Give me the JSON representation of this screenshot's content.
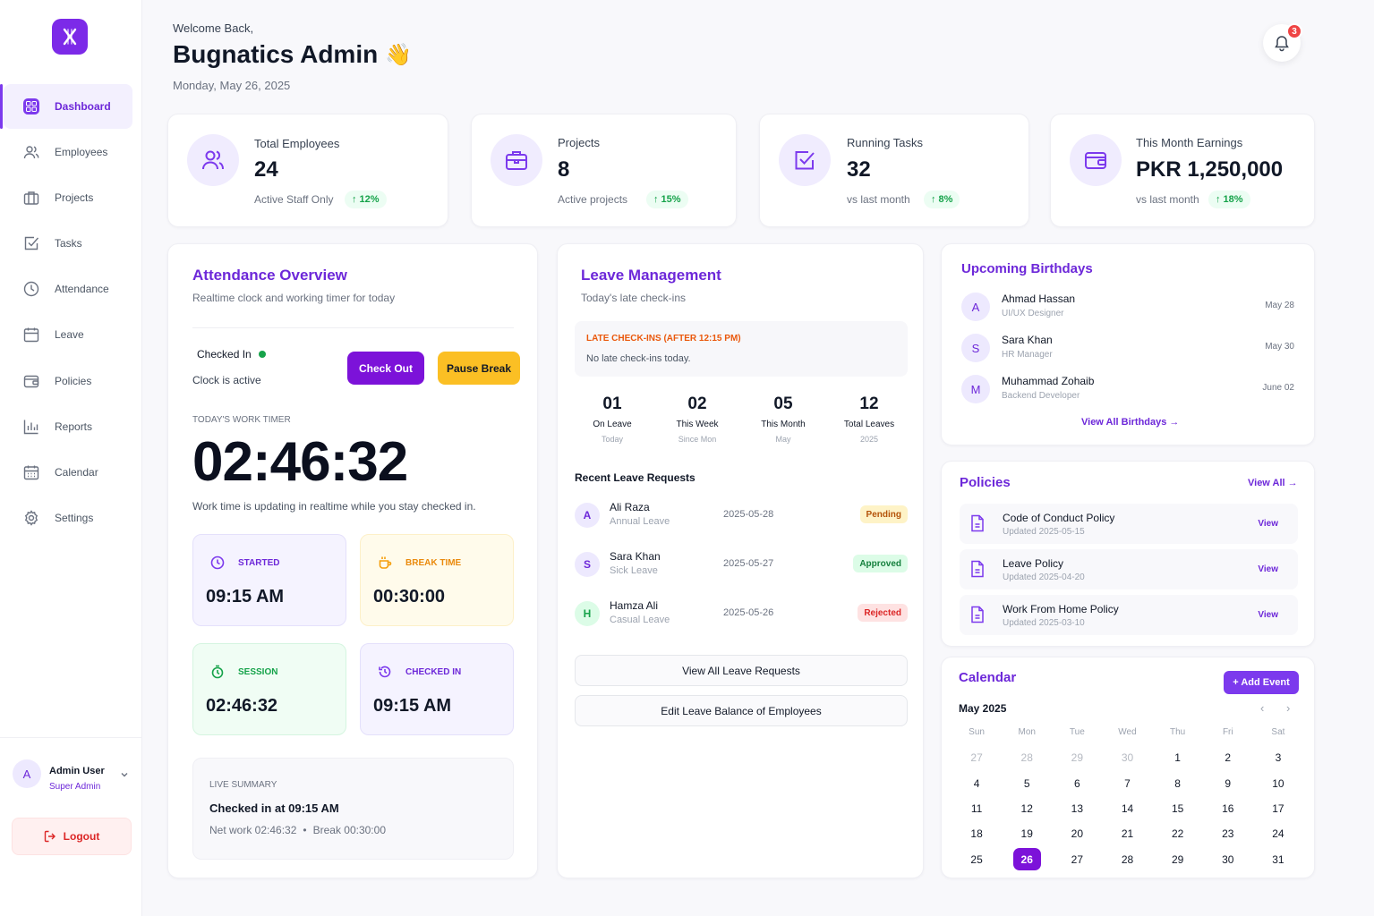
{
  "sidebar": {
    "items": [
      {
        "label": "Dashboard",
        "icon": "grid-icon"
      },
      {
        "label": "Employees",
        "icon": "users-icon"
      },
      {
        "label": "Projects",
        "icon": "briefcase-icon"
      },
      {
        "label": "Tasks",
        "icon": "check-square-icon"
      },
      {
        "label": "Attendance",
        "icon": "clock-icon"
      },
      {
        "label": "Leave",
        "icon": "calendar-icon"
      },
      {
        "label": "Policies",
        "icon": "wallet-icon"
      },
      {
        "label": "Reports",
        "icon": "bar-chart-icon"
      },
      {
        "label": "Calendar",
        "icon": "calendar-grid-icon"
      },
      {
        "label": "Settings",
        "icon": "gear-icon"
      }
    ],
    "profile": {
      "initial": "A",
      "name": "Admin User",
      "role": "Super Admin"
    },
    "logout_label": "Logout"
  },
  "header": {
    "welcome": "Welcome Back,",
    "name": "Bugnatics Admin",
    "emoji": "👋",
    "date": "Monday, May 26, 2025",
    "notification_count": "3"
  },
  "stats": [
    {
      "label": "Total Employees",
      "value": "24",
      "sub": "Active Staff Only",
      "trend": "↑ 12%",
      "icon": "users-icon"
    },
    {
      "label": "Projects",
      "value": "8",
      "sub": "Active projects",
      "trend": "↑ 15%",
      "icon": "briefcase-icon"
    },
    {
      "label": "Running Tasks",
      "value": "32",
      "sub": "vs last month",
      "trend": "↑ 8%",
      "icon": "check-square-icon"
    },
    {
      "label": "This Month Earnings",
      "value": "PKR 1,250,000",
      "sub": "vs last month",
      "trend": "↑ 18%",
      "icon": "wallet-icon"
    }
  ],
  "attendance": {
    "title": "Attendance Overview",
    "subtitle": "Realtime clock and working timer for today",
    "status": "Checked In",
    "clock_status": "Clock is active",
    "checkout_label": "Check Out",
    "pause_label": "Pause Break",
    "timer_label": "TODAY'S WORK TIMER",
    "timer": "02:46:32",
    "timer_note": "Work time is updating in realtime while you stay checked in.",
    "tiles": [
      {
        "label": "STARTED",
        "value": "09:15 AM"
      },
      {
        "label": "BREAK TIME",
        "value": "00:30:00"
      },
      {
        "label": "SESSION",
        "value": "02:46:32"
      },
      {
        "label": "CHECKED IN",
        "value": "09:15 AM"
      }
    ],
    "summary": {
      "label": "LIVE SUMMARY",
      "headline": "Checked in at 09:15 AM",
      "net": "Net work 02:46:32",
      "sep": "•",
      "break": "Break 00:30:00"
    }
  },
  "leave": {
    "title": "Leave Management",
    "subtitle": "Today's late check-ins",
    "late_title": "LATE CHECK-INS (AFTER 12:15 PM)",
    "late_text": "No late check-ins today.",
    "stats": [
      {
        "n": "01",
        "label": "On Leave",
        "sub": "Today"
      },
      {
        "n": "02",
        "label": "This Week",
        "sub": "Since Mon"
      },
      {
        "n": "05",
        "label": "This Month",
        "sub": "May"
      },
      {
        "n": "12",
        "label": "Total Leaves",
        "sub": "2025"
      }
    ],
    "recent_title": "Recent Leave Requests",
    "requests": [
      {
        "initial": "A",
        "name": "Ali Raza",
        "type": "Annual Leave",
        "date": "2025-05-28",
        "status": "Pending"
      },
      {
        "initial": "S",
        "name": "Sara Khan",
        "type": "Sick Leave",
        "date": "2025-05-27",
        "status": "Approved"
      },
      {
        "initial": "H",
        "name": "Hamza Ali",
        "type": "Casual Leave",
        "date": "2025-05-26",
        "status": "Rejected"
      }
    ],
    "view_all_label": "View All Leave Requests",
    "edit_balance_label": "Edit Leave Balance of Employees"
  },
  "birthdays": {
    "title": "Upcoming Birthdays",
    "people": [
      {
        "initial": "A",
        "name": "Ahmad Hassan",
        "role": "UI/UX Designer",
        "date": "May 28"
      },
      {
        "initial": "S",
        "name": "Sara Khan",
        "role": "HR Manager",
        "date": "May 30"
      },
      {
        "initial": "M",
        "name": "Muhammad Zohaib",
        "role": "Backend Developer",
        "date": "June 02"
      }
    ],
    "view_all": "View All Birthdays →"
  },
  "policies": {
    "title": "Policies",
    "view_all": "View All →",
    "items": [
      {
        "name": "Code of Conduct Policy",
        "updated": "Updated 2025-05-15",
        "action": "View"
      },
      {
        "name": "Leave Policy",
        "updated": "Updated 2025-04-20",
        "action": "View"
      },
      {
        "name": "Work From Home Policy",
        "updated": "Updated 2025-03-10",
        "action": "View"
      }
    ]
  },
  "calendar": {
    "title": "Calendar",
    "add_event": "+ Add Event",
    "month": "May 2025",
    "prev": "‹",
    "next": "›",
    "weekdays": [
      "Sun",
      "Mon",
      "Tue",
      "Wed",
      "Thu",
      "Fri",
      "Sat"
    ],
    "weeks": [
      [
        "27",
        "28",
        "29",
        "30",
        "1",
        "2",
        "3"
      ],
      [
        "4",
        "5",
        "6",
        "7",
        "8",
        "9",
        "10"
      ],
      [
        "11",
        "12",
        "13",
        "14",
        "15",
        "16",
        "17"
      ],
      [
        "18",
        "19",
        "20",
        "21",
        "22",
        "23",
        "24"
      ],
      [
        "25",
        "26",
        "27",
        "28",
        "29",
        "30",
        "31"
      ]
    ],
    "today": "26"
  },
  "colors": {
    "brand": "#7c12d9",
    "accent": "#7c3aed",
    "success": "#16a34a",
    "warning": "#f59e0b",
    "danger": "#dc2626"
  }
}
